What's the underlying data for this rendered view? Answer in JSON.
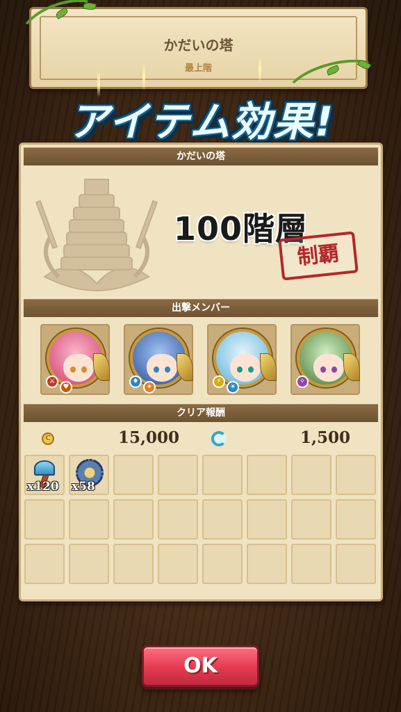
{
  "top_card": {
    "title": "かだいの塔",
    "subtitle": "最上階"
  },
  "banner": {
    "text": "アイテム効果!"
  },
  "panel": {
    "section_tower": "かだいの塔",
    "floors": "100階層",
    "stamp": "制覇",
    "section_members": "出撃メンバー",
    "members": [
      {
        "name": "member-1",
        "ring_color": "#d23c6e",
        "hair_color": "#e0457a",
        "element_a": "#c0392b",
        "element_b": "#d35400",
        "element_a_symbol": "⚔",
        "element_b_symbol": "♥"
      },
      {
        "name": "member-2",
        "ring_color": "#2f5fb4",
        "hair_color": "#2d4f9e",
        "element_a": "#2e86c1",
        "element_b": "#e67e22",
        "element_a_symbol": "♦",
        "element_b_symbol": "✦"
      },
      {
        "name": "member-3",
        "ring_color": "#5ab3d9",
        "hair_color": "#9cd4ee",
        "element_a": "#d4ac0d",
        "element_b": "#2e86c1",
        "element_a_symbol": "⚡",
        "element_b_symbol": "☀"
      },
      {
        "name": "member-4",
        "ring_color": "#4a7a3a",
        "hair_color": "#7fbf6a",
        "element_a": "#8e44ad",
        "element_b": "#d35400",
        "element_a_symbol": "✧",
        "element_b_symbol": "♪"
      }
    ],
    "section_rewards": "クリア報酬",
    "gold_icon": "coin-icon",
    "gold_value": "15,000",
    "spirit_icon": "spirit-icon",
    "spirit_value": "1,500",
    "items": [
      {
        "icon": "axe-icon",
        "count": "x120"
      },
      {
        "icon": "gear-icon",
        "count": "x58"
      }
    ]
  },
  "ok_button": {
    "label": "OK"
  }
}
